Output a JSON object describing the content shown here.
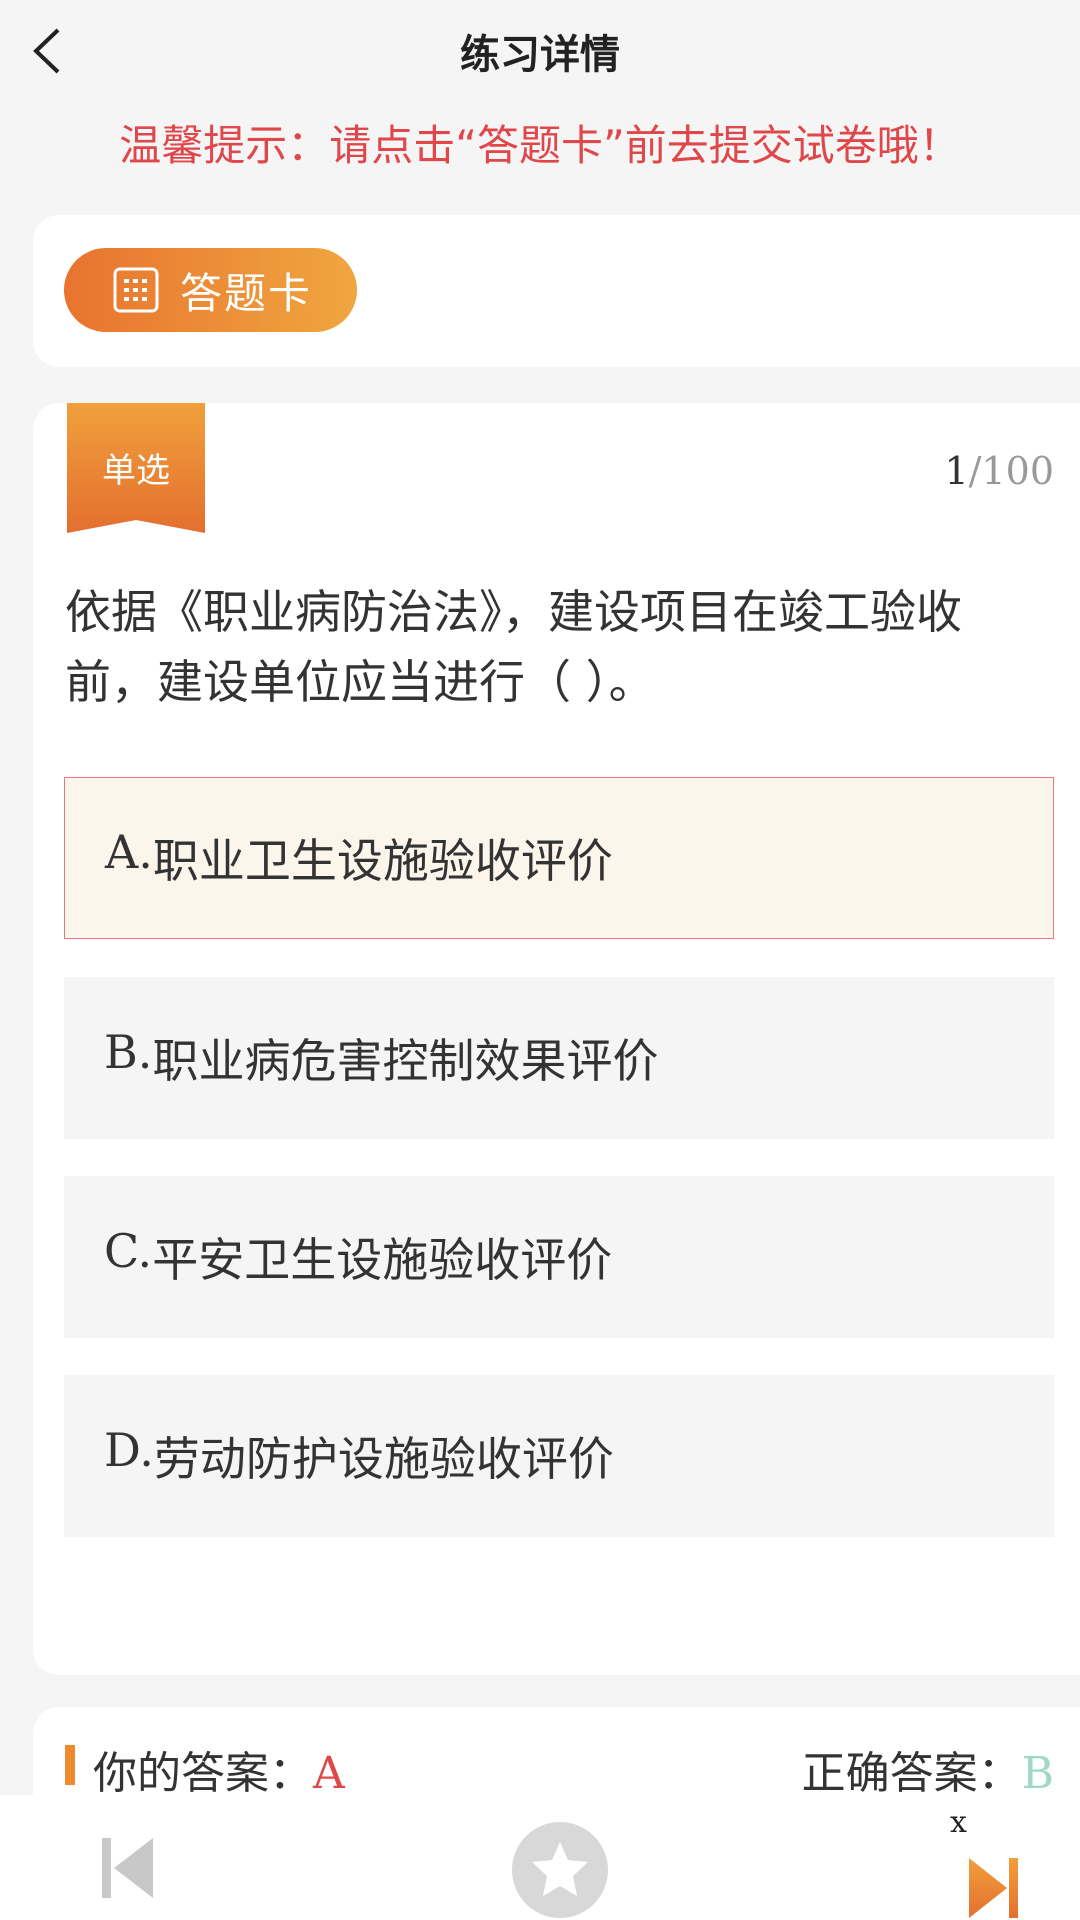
{
  "header": {
    "title": "练习详情"
  },
  "tip": "温馨提示：请点击“答题卡”前去提交试卷哦！",
  "answer_card": {
    "label": "答题卡"
  },
  "question": {
    "type": "单选",
    "index": "1",
    "total": "/100",
    "text": "依据《职业病防治法》，建设项目在竣工验收前，建设单位应当进行（ ）。",
    "options": [
      {
        "letter": "A.",
        "text": "职业卫生设施验收评价"
      },
      {
        "letter": "B.",
        "text": "职业病危害控制效果评价"
      },
      {
        "letter": "C.",
        "text": "平安卫生设施验收评价"
      },
      {
        "letter": "D.",
        "text": "劳动防护设施验收评价"
      }
    ],
    "selected": "A"
  },
  "result": {
    "your_label": "你的答案：",
    "your_value": "A",
    "correct_label": "正确答案：",
    "correct_value": "B"
  },
  "footer": {
    "close_label": "x"
  },
  "colors": {
    "accent": "#f08a2e",
    "wrong": "#e0474a",
    "right": "#9fd7c8"
  },
  "icons": [
    "back-icon",
    "grid-icon",
    "prev-icon",
    "star-icon",
    "next-icon"
  ]
}
